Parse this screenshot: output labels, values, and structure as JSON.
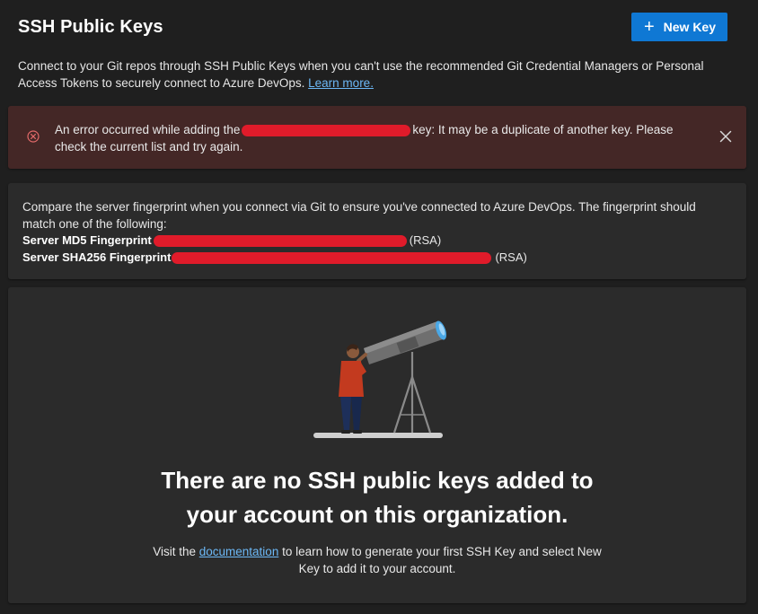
{
  "header": {
    "title": "SSH Public Keys",
    "new_key_label": "New Key"
  },
  "intro": {
    "text": "Connect to your Git repos through SSH Public Keys when you can't use the recommended Git Credential Managers or Personal Access Tokens to securely connect to Azure DevOps. ",
    "link_label": "Learn more."
  },
  "error": {
    "prefix": "An error occurred while adding the",
    "suffix": "key: It may be a duplicate of another key. Please check the current list and try again."
  },
  "fingerprint": {
    "intro": "Compare the server fingerprint when you connect via Git to ensure you've connected to Azure DevOps. The fingerprint should match one of the following:",
    "md5_label": "Server MD5 Fingerprint",
    "md5_suffix": "(RSA)",
    "sha256_label": "Server SHA256 Fingerprint",
    "sha256_suffix": "(RSA)"
  },
  "empty_state": {
    "title_line1": "There are no SSH public keys added to",
    "title_line2": "your account on this organization.",
    "desc_before": "Visit the ",
    "desc_link": "documentation",
    "desc_after": " to learn how to generate your first SSH Key and select New Key to add it to your account."
  },
  "icons": {
    "new_key": "plus-icon",
    "error": "error-circle-icon",
    "close": "close-icon"
  },
  "colors": {
    "accent": "#0f78d4",
    "link": "#6cb8f6",
    "error_bg": "#442726",
    "error_icon": "#e36a6a",
    "redaction": "#e01b2a"
  }
}
